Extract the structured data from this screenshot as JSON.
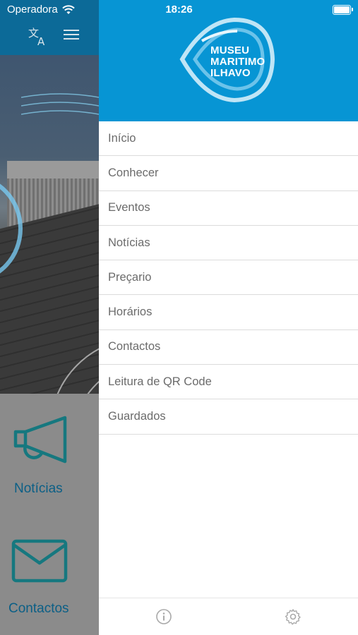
{
  "status_bar": {
    "carrier": "Operadora",
    "time": "18:26"
  },
  "background_app": {
    "tiles": [
      {
        "label": "Notícias",
        "icon": "megaphone-icon"
      },
      {
        "label": "Contactos",
        "icon": "envelope-icon"
      }
    ],
    "header_icons": [
      "translate-icon",
      "hamburger-menu-icon"
    ]
  },
  "drawer": {
    "logo": {
      "line1": "MUSEU",
      "line2": "MARITIMO",
      "line3": "ILHAVO"
    },
    "menu_items": [
      "Início",
      "Conhecer",
      "Eventos",
      "Notícias",
      "Preçario",
      "Horários",
      "Contactos",
      "Leitura de QR Code",
      "Guardados"
    ],
    "footer_icons": [
      "info-icon",
      "settings-gear-icon"
    ]
  },
  "colors": {
    "header_blue": "#0795d4",
    "dark_blue": "#0c6a98",
    "teal": "#16787f",
    "menu_text": "#6b6b6b"
  }
}
